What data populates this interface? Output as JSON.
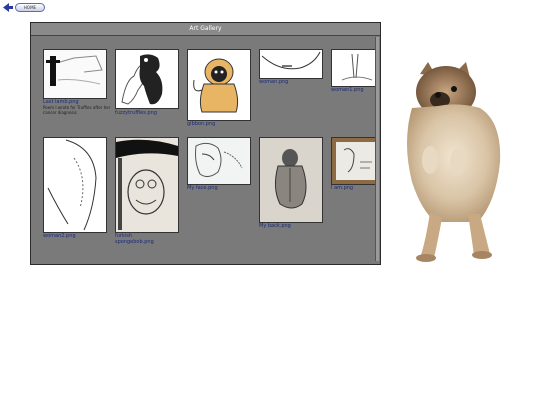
{
  "nav": {
    "home_label": "HOME"
  },
  "gallery": {
    "title": "Art Gallery",
    "items": [
      {
        "caption": "Last lamb.png",
        "description": "Poem I wrote for Truffles after her cancer diagnosis"
      },
      {
        "caption": "fuzzytruffles.png"
      },
      {
        "caption": "gibbon.png"
      },
      {
        "caption": "woman.png"
      },
      {
        "caption": "woman1.png"
      },
      {
        "caption": "woman2.png"
      },
      {
        "caption": "furkish\nspongebob.png"
      },
      {
        "caption": "My face.png"
      },
      {
        "caption": "My back.png"
      },
      {
        "caption": "I am.png"
      }
    ]
  }
}
